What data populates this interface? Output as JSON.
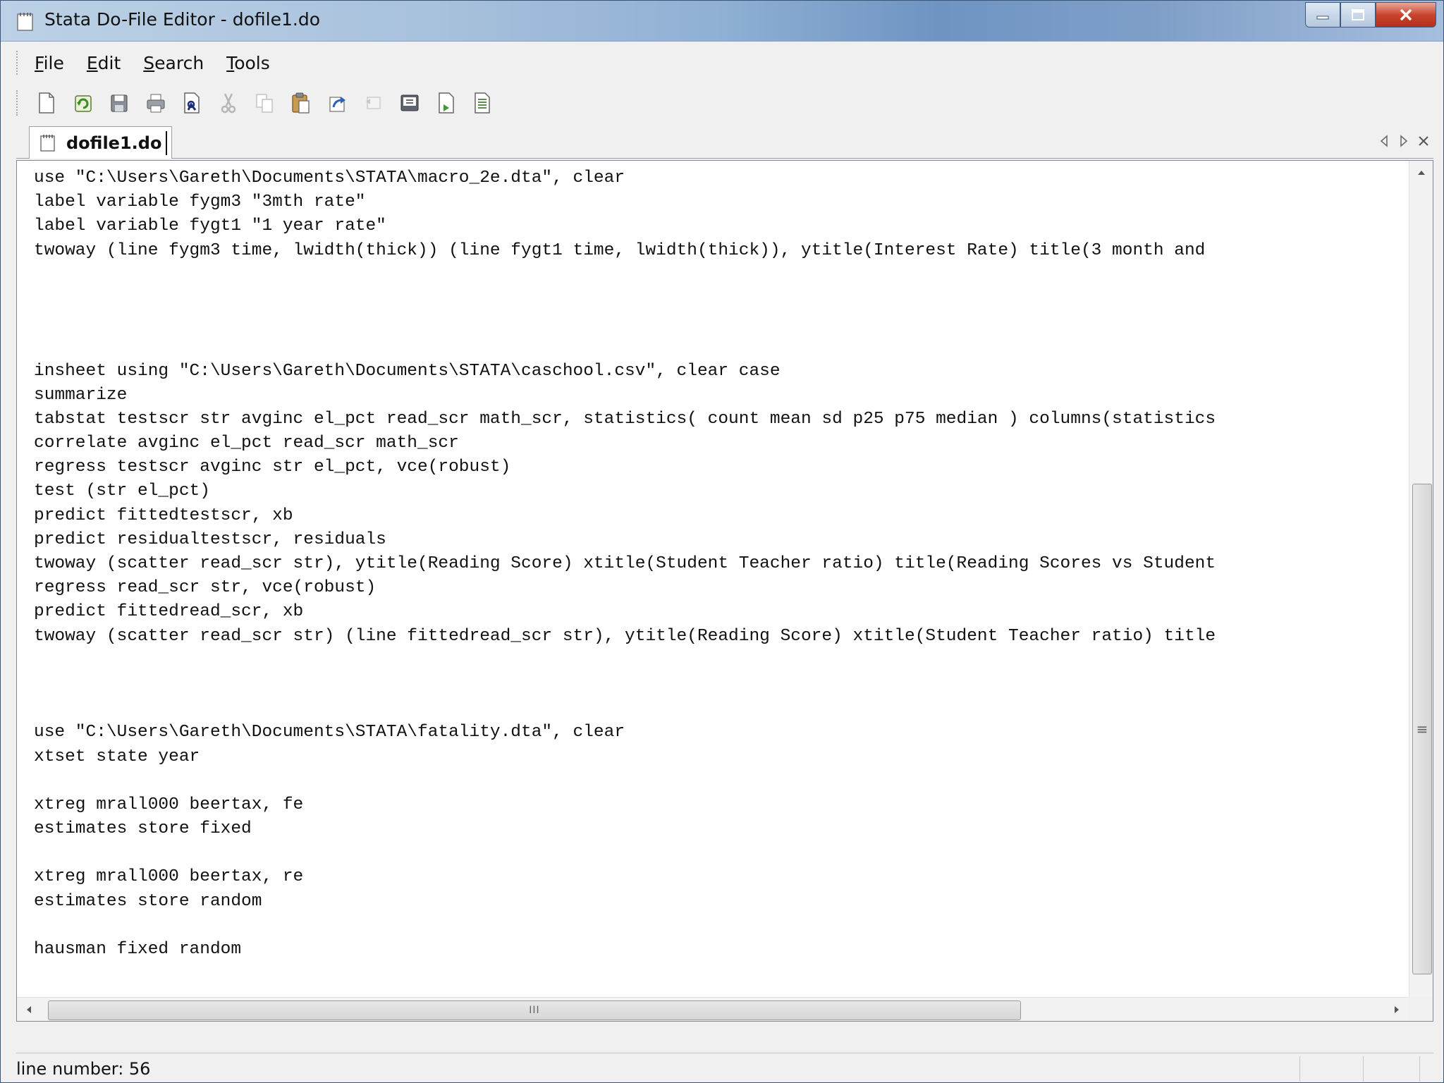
{
  "window": {
    "title": "Stata Do-File Editor - dofile1.do"
  },
  "menu": [
    {
      "pre": "",
      "u": "F",
      "post": "ile"
    },
    {
      "pre": "",
      "u": "E",
      "post": "dit"
    },
    {
      "pre": "",
      "u": "S",
      "post": "earch"
    },
    {
      "pre": "",
      "u": "T",
      "post": "ools"
    }
  ],
  "toolbar": {
    "icons": [
      "new-file-icon",
      "open-file-icon",
      "save-icon",
      "print-icon",
      "find-icon",
      "cut-icon",
      "copy-icon",
      "paste-icon",
      "undo-icon",
      "redo-icon",
      "preview-icon",
      "run-icon",
      "do-icon"
    ]
  },
  "tab": {
    "label": "dofile1.do"
  },
  "editor": {
    "lines": [
      "use \"C:\\Users\\Gareth\\Documents\\STATA\\macro_2e.dta\", clear",
      "label variable fygm3 \"3mth rate\"",
      "label variable fygt1 \"1 year rate\"",
      "twoway (line fygm3 time, lwidth(thick)) (line fygt1 time, lwidth(thick)), ytitle(Interest Rate) title(3 month and",
      "",
      "",
      "",
      "",
      "insheet using \"C:\\Users\\Gareth\\Documents\\STATA\\caschool.csv\", clear case",
      "summarize",
      "tabstat testscr str avginc el_pct read_scr math_scr, statistics( count mean sd p25 p75 median ) columns(statistics",
      "correlate avginc el_pct read_scr math_scr",
      "regress testscr avginc str el_pct, vce(robust)",
      "test (str el_pct)",
      "predict fittedtestscr, xb",
      "predict residualtestscr, residuals",
      "twoway (scatter read_scr str), ytitle(Reading Score) xtitle(Student Teacher ratio) title(Reading Scores vs Student",
      "regress read_scr str, vce(robust)",
      "predict fittedread_scr, xb",
      "twoway (scatter read_scr str) (line fittedread_scr str), ytitle(Reading Score) xtitle(Student Teacher ratio) title",
      "",
      "",
      "",
      "use \"C:\\Users\\Gareth\\Documents\\STATA\\fatality.dta\", clear",
      "xtset state year",
      "",
      "xtreg mrall000 beertax, fe",
      "estimates store fixed",
      "",
      "xtreg mrall000 beertax, re",
      "estimates store random",
      "",
      "hausman fixed random"
    ]
  },
  "scrollbar": {
    "v_grip": "≡",
    "h_grip": "III"
  },
  "status": {
    "line_number": "line number: 56"
  }
}
